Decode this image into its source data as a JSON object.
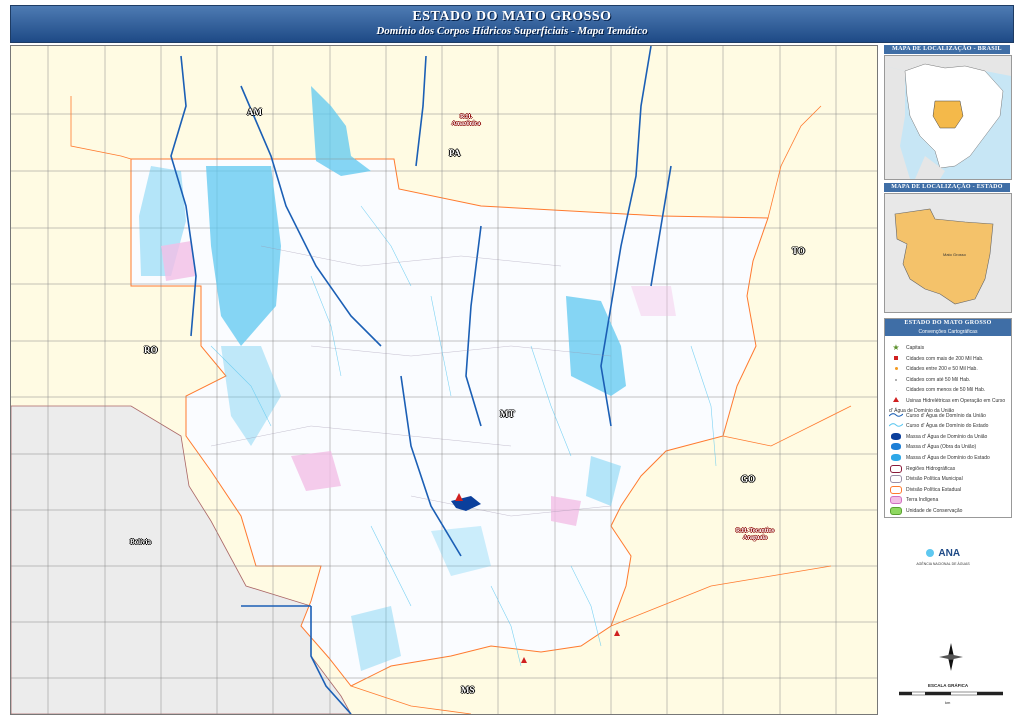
{
  "header": {
    "title": "ESTADO DO MATO GROSSO",
    "subtitle": "Domínio dos Corpos Hídricos Superficiais - Mapa Temático"
  },
  "map_labels": {
    "AM": "AM",
    "PA": "PA",
    "TO": "TO",
    "RO": "RO",
    "MT": "MT",
    "GO": "GO",
    "MS": "MS",
    "bolivia": "Bolívia",
    "rh_amazonica": "R.H. Amazônica",
    "rh_tocantins": "R.H. Tocantins Araguaia"
  },
  "panels": {
    "brasil_title": "MAPA DE LOCALIZAÇÃO - BRASIL",
    "estado_title": "MAPA DE LOCALIZAÇÃO - ESTADO",
    "mt_label": "Mato Grosso",
    "legend_title": "ESTADO DO MATO GROSSO",
    "legend_subtitle": "Convenções Cartográficas"
  },
  "legend": {
    "items": [
      {
        "label": "Capitais",
        "icon": "star-icon"
      },
      {
        "label": "Cidades com mais de 200 Mil Hab.",
        "icon": "square-red-icon"
      },
      {
        "label": "Cidades entre 200 e 50 Mil Hab.",
        "icon": "dot-orange-icon"
      },
      {
        "label": "Cidades com até 50 Mil Hab.",
        "icon": "dot-small-icon"
      },
      {
        "label": "Cidades com menos de 50 Mil Hab.",
        "icon": "dot-tiny-icon"
      },
      {
        "label": "Usinas Hidrelétricas em Operação em Curso d' Água de Domínio da União",
        "icon": "triangle-red-icon"
      },
      {
        "label": "Curso d' Água de Domínio da União",
        "icon": "river-dark-icon"
      },
      {
        "label": "Curso d' Água de Domínio do Estado",
        "icon": "river-light-icon"
      },
      {
        "label": "Massa d' Água de Domínio da União",
        "icon": "water-dark-icon"
      },
      {
        "label": "Massa d' Água (Obra da União)",
        "icon": "water-mid-icon"
      },
      {
        "label": "Massa d' Água de Domínio do Estado",
        "icon": "water-light-icon"
      },
      {
        "label": "Regiões Hidrográficas",
        "icon": "region-icon"
      },
      {
        "label": "Divisão Política Municipal",
        "icon": "municipal-icon"
      },
      {
        "label": "Divisão Política Estadual",
        "icon": "state-icon"
      },
      {
        "label": "Terra Indígena",
        "icon": "indigenous-icon"
      },
      {
        "label": "Unidade de Conservação",
        "icon": "conservation-icon"
      }
    ],
    "colors": {
      "river_union": "#1b5fb5",
      "river_state": "#5ec8f0",
      "water_union": "#0b3f9c",
      "water_state": "#2fa8e8",
      "indigenous": "#f3bfe6",
      "conservation": "#8ed860",
      "state_border": "#ff7a2f",
      "municipal_border": "#9a8fa8"
    }
  },
  "logo": {
    "text": "ANA",
    "subtitle": "AGÊNCIA NACIONAL DE ÁGUAS"
  },
  "scale": {
    "title": "ESCALA GRÁFICA",
    "ticks": [
      "0",
      "25",
      "50",
      "100",
      "150",
      "200"
    ],
    "unit": "km"
  }
}
